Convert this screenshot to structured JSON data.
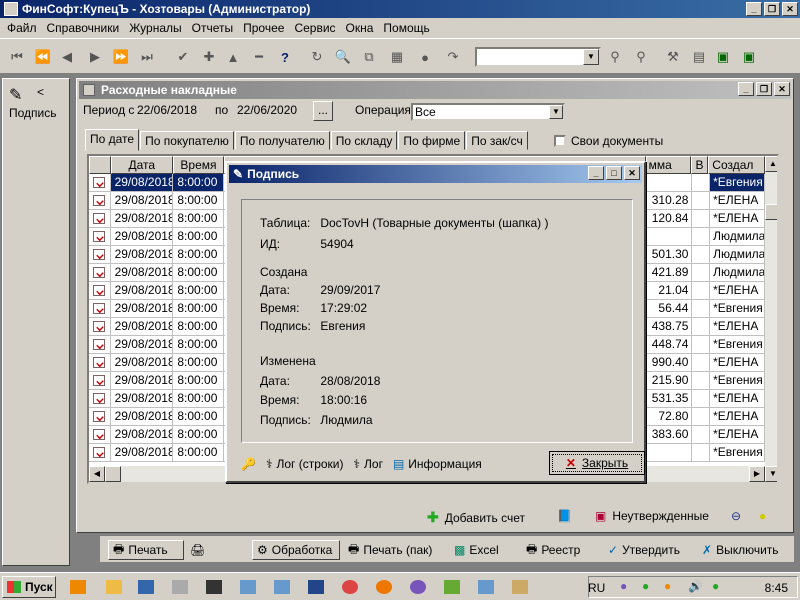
{
  "app": {
    "title": "ФинСофт:КупецЪ - Хозтовары  (Администратор)"
  },
  "menu": [
    "Файл",
    "Справочники",
    "Журналы",
    "Отчеты",
    "Прочее",
    "Сервис",
    "Окна",
    "Помощь"
  ],
  "side_panel": {
    "label": "Подпись",
    "arrow": "<"
  },
  "doc_window": {
    "title": "Расходные накладные",
    "period_from_label": "Период с",
    "period_from": "22/06/2018",
    "period_to_label": "по",
    "period_to": "22/06/2020",
    "ellipsis": "...",
    "operation_label": "Операция:",
    "operation_value": "Все",
    "tabs": [
      "По дате",
      "По покупателю",
      "По получателю",
      "По складу",
      "По фирме",
      "По зак/сч"
    ],
    "own_docs_label": "Свои документы",
    "columns": {
      "date": "Дата",
      "time": "Время",
      "sum": "мма",
      "v": "В",
      "created_by": "Создал"
    },
    "rows": [
      {
        "date": "29/08/2018",
        "time": "8:00:00",
        "sum": "",
        "by": "*Евгения"
      },
      {
        "date": "29/08/2018",
        "time": "8:00:00",
        "sum": "310.28",
        "by": "*ЕЛЕНА"
      },
      {
        "date": "29/08/2018",
        "time": "8:00:00",
        "sum": "120.84",
        "by": "*ЕЛЕНА"
      },
      {
        "date": "29/08/2018",
        "time": "8:00:00",
        "sum": "",
        "by": "Людмила"
      },
      {
        "date": "29/08/2018",
        "time": "8:00:00",
        "sum": "501.30",
        "by": "Людмила"
      },
      {
        "date": "29/08/2018",
        "time": "8:00:00",
        "sum": "421.89",
        "by": "Людмила"
      },
      {
        "date": "29/08/2018",
        "time": "8:00:00",
        "sum": "21.04",
        "by": "*ЕЛЕНА"
      },
      {
        "date": "29/08/2018",
        "time": "8:00:00",
        "sum": "56.44",
        "by": "*Евгения"
      },
      {
        "date": "29/08/2018",
        "time": "8:00:00",
        "sum": "438.75",
        "by": "*ЕЛЕНА"
      },
      {
        "date": "29/08/2018",
        "time": "8:00:00",
        "sum": "448.74",
        "by": "*Евгения"
      },
      {
        "date": "29/08/2018",
        "time": "8:00:00",
        "sum": "990.40",
        "by": "*ЕЛЕНА"
      },
      {
        "date": "29/08/2018",
        "time": "8:00:00",
        "sum": "215.90",
        "by": "*Евгения"
      },
      {
        "date": "29/08/2018",
        "time": "8:00:00",
        "sum": "531.35",
        "by": "*ЕЛЕНА"
      },
      {
        "date": "29/08/2018",
        "time": "8:00:00",
        "sum": "72.80",
        "by": "*ЕЛЕНА"
      },
      {
        "date": "29/08/2018",
        "time": "8:00:00",
        "sum": "383.60",
        "by": "*ЕЛЕНА"
      },
      {
        "date": "29/08/2018",
        "time": "8:00:00",
        "sum": "",
        "by": "*Евгения"
      }
    ],
    "add_invoice": "Добавить счет",
    "unconfirmed": "Неутвержденные"
  },
  "bottom_bar": {
    "print": "Печать",
    "process": "Обработка",
    "print_batch": "Печать (пак)",
    "excel": "Excel",
    "registry": "Реестр",
    "approve": "Утвердить",
    "exclude": "Выключить"
  },
  "dialog": {
    "title": "Подпись",
    "table_label": "Таблица:",
    "table_value": "DocTovH (Товарные документы (шапка) )",
    "id_label": "ИД:",
    "id_value": "54904",
    "created_header": "Создана",
    "date_label": "Дата:",
    "time_label": "Время:",
    "sign_label": "Подпись:",
    "created_date": "29/09/2017",
    "created_time": "17:29:02",
    "created_by": "Евгения",
    "changed_header": "Изменена",
    "changed_date": "28/08/2018",
    "changed_time": "18:00:16",
    "changed_by": "Людмила",
    "log_rows": "Лог (строки)",
    "log": "Лог",
    "info": "Информация",
    "close": "Закрыть"
  },
  "taskbar": {
    "start": "Пуск",
    "lang": "RU",
    "clock": "8:45"
  }
}
